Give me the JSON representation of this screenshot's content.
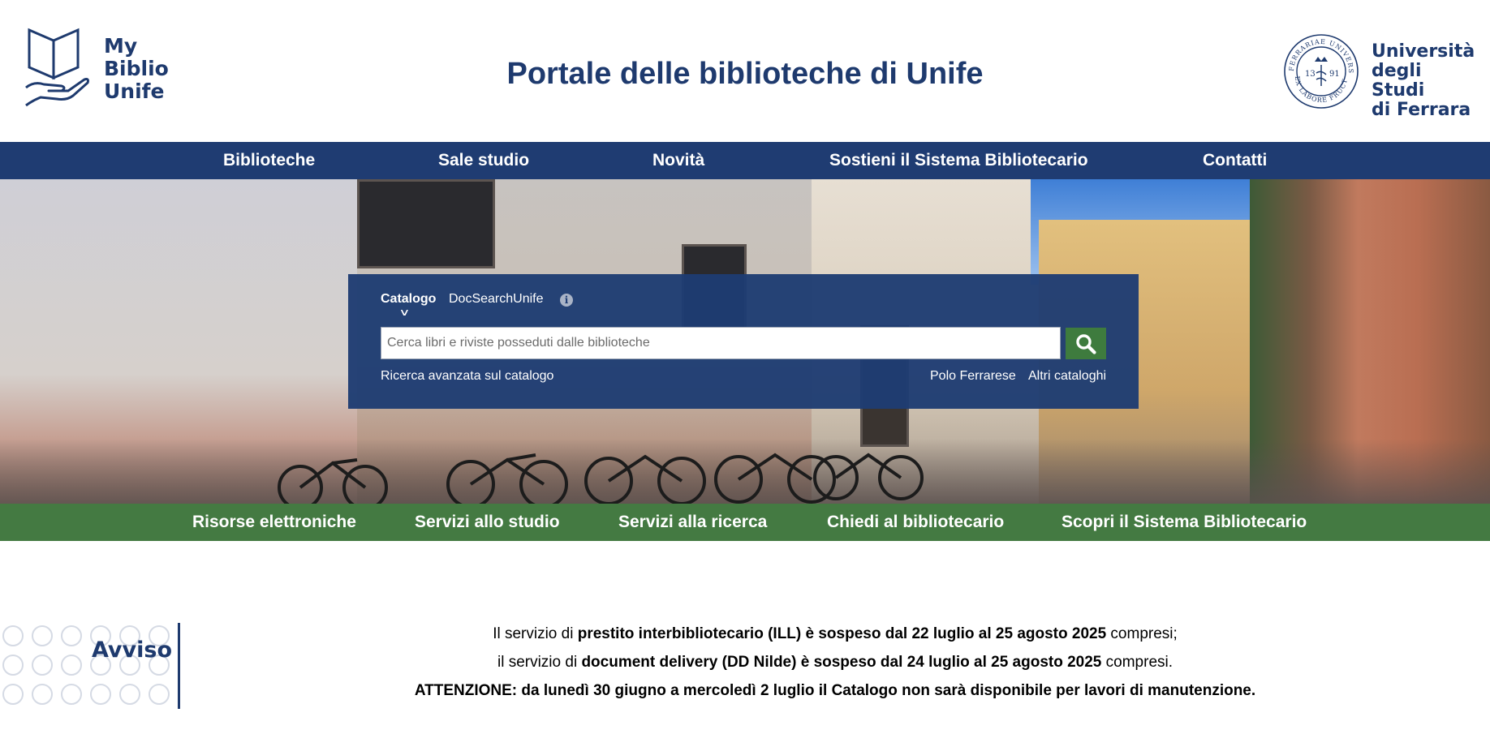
{
  "header": {
    "logo_left_lines": [
      "My",
      "Biblio",
      "Unife"
    ],
    "title": "Portale delle biblioteche di Unife",
    "logo_right_lines": [
      "Università",
      "degli Studi",
      "di Ferrara"
    ],
    "seal_text_top": "FERRARIAE UNIVERSITAS",
    "seal_text_bottom": "EX LABORE FRUCTUS",
    "seal_year_left": "13",
    "seal_year_right": "91"
  },
  "topnav": {
    "items": [
      "Biblioteche",
      "Sale studio",
      "Novità",
      "Sostieni il Sistema Bibliotecario",
      "Contatti"
    ]
  },
  "search": {
    "tabs": [
      "Catalogo",
      "DocSearchUnife"
    ],
    "active_tab": "Catalogo",
    "info_icon": "info-icon",
    "placeholder": "Cerca libri e riviste posseduti dalle biblioteche",
    "value": "",
    "button_icon": "magnifier-icon",
    "advanced_link": "Ricerca avanzata sul catalogo",
    "links_right": [
      "Polo Ferrarese",
      "Altri cataloghi"
    ]
  },
  "greennav": {
    "items": [
      "Risorse elettroniche",
      "Servizi allo studio",
      "Servizi alla ricerca",
      "Chiedi al bibliotecario",
      "Scopri il Sistema Bibliotecario"
    ]
  },
  "notice": {
    "label": "Avviso",
    "line1": {
      "pre": "Il servizio di ",
      "bold": "prestito interbibliotecario (ILL) è sospeso dal 22 luglio al 25 agosto 2025",
      "post": " compresi;"
    },
    "line2": {
      "pre": "il servizio di ",
      "bold": "document delivery (DD Nilde) è sospeso dal 24 luglio al 25 agosto 2025",
      "post": " compresi."
    },
    "line3": {
      "bold": "ATTENZIONE: da lunedì 30 giugno a mercoledì 2 luglio il Catalogo non sarà disponibile per lavori di manutenzione."
    }
  },
  "colors": {
    "primary_blue": "#1f3c72",
    "accent_green": "#447a42",
    "search_button_green": "#3e7b3e"
  }
}
